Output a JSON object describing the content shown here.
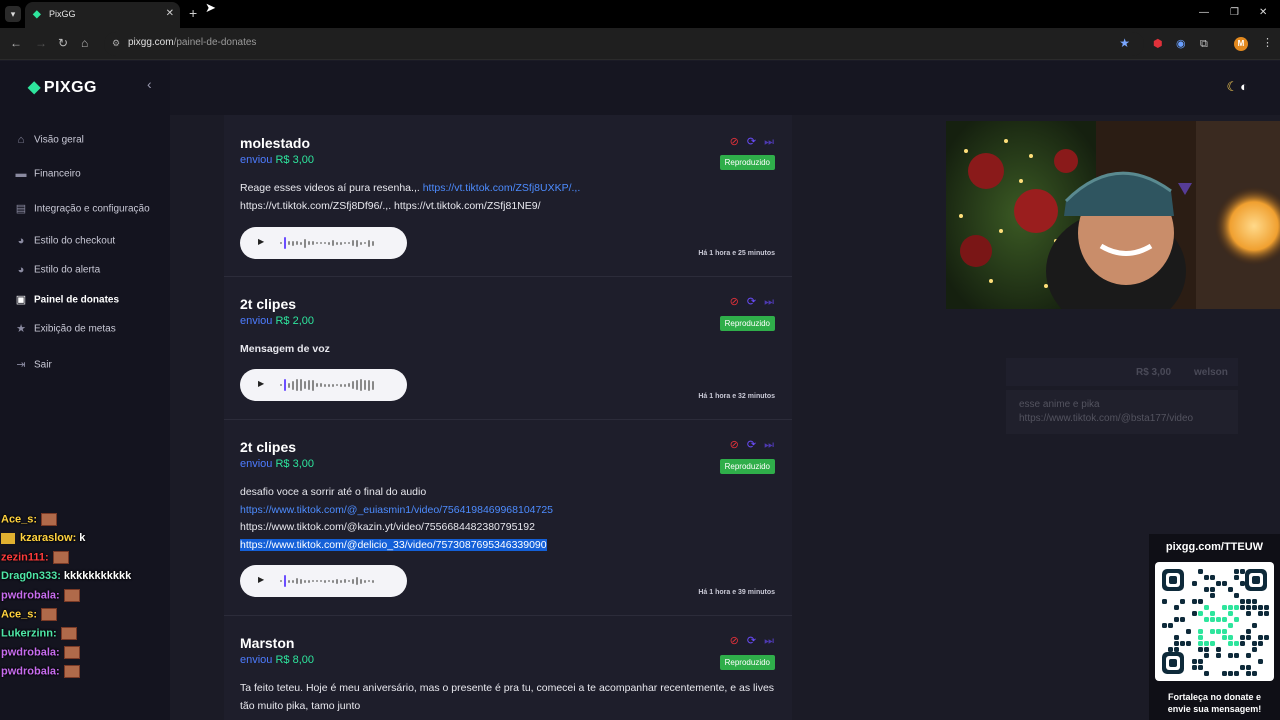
{
  "browser": {
    "tab_title": "PixGG",
    "url_domain": "pixgg.com",
    "url_path": "/painel-de-donates"
  },
  "app": {
    "logo": "PIXGG",
    "sidebar": [
      {
        "label": "Visão geral",
        "icon": "home-icon"
      },
      {
        "label": "Financeiro",
        "icon": "card-icon"
      },
      {
        "label": "Integração e configuração",
        "icon": "settings-icon"
      },
      {
        "label": "Estilo do checkout",
        "icon": "palette-icon"
      },
      {
        "label": "Estilo do alerta",
        "icon": "palette-icon"
      },
      {
        "label": "Painel de donates",
        "icon": "gift-icon",
        "active": true
      },
      {
        "label": "Exibição de metas",
        "icon": "star-icon"
      },
      {
        "label": "Sair",
        "icon": "logout-icon"
      }
    ]
  },
  "donations": [
    {
      "name": "molestado",
      "sent_label": "enviou",
      "amount": "R$ 3,00",
      "status": "Reproduzido",
      "message_parts": [
        {
          "t": "Reage esses videos aí pura resenha.,. ",
          "kind": "plain"
        },
        {
          "t": "https://vt.tiktok.com/ZSfj8UXKP/.,.",
          "kind": "link"
        },
        {
          "t": "https://vt.tiktok.com/ZSfj8Df96/.,. https://vt.tiktok.com/ZSfj81NE9/",
          "kind": "plain",
          "newline": true
        }
      ],
      "time": "Há 1 hora e 25 minutos"
    },
    {
      "name": "2t clipes",
      "sent_label": "enviou",
      "amount": "R$ 2,00",
      "status": "Reproduzido",
      "message_parts": [
        {
          "t": "Mensagem de voz",
          "kind": "bold"
        }
      ],
      "time": "Há 1 hora e 32 minutos"
    },
    {
      "name": "2t clipes",
      "sent_label": "enviou",
      "amount": "R$ 3,00",
      "status": "Reproduzido",
      "message_parts": [
        {
          "t": "desafio voce a sorrir até o final do audio",
          "kind": "plain"
        },
        {
          "t": "https://www.tiktok.com/@_euiasmin1/video/7564198469968104725",
          "kind": "link",
          "newline": true
        },
        {
          "t": "https://www.tiktok.com/@kazin.yt/video/7556684482380795192",
          "kind": "plain",
          "newline": true
        },
        {
          "t": "https://www.tiktok.com/@delicio_33/video/7573087695346339090",
          "kind": "sel",
          "newline": true
        }
      ],
      "time": "Há 1 hora e 39 minutos"
    },
    {
      "name": "Marston",
      "sent_label": "enviou",
      "amount": "R$ 8,00",
      "status": "Reproduzido",
      "message_parts": [
        {
          "t": "Ta feito teteu. Hoje é meu aniversário, mas o presente é pra tu, comecei a te acompanhar recentemente, e as lives tão muito pika, tamo junto",
          "kind": "plain"
        }
      ],
      "time": ""
    }
  ],
  "ghost_donation": {
    "amount": "R$ 3,00",
    "user": "welson",
    "line1": "esse anime e pika",
    "line2": "https://www.tiktok.com/@bsta177/video"
  },
  "chat": [
    {
      "user": "Ace_s:",
      "color": "#ffd23f",
      "msg": "",
      "emote": true
    },
    {
      "user": "kzaraslow:",
      "color": "#ffd23f",
      "msg": "k",
      "badge": true
    },
    {
      "user": "zezin111:",
      "color": "#ff3b3b",
      "msg": "",
      "emote": true
    },
    {
      "user": "Drag0n333:",
      "color": "#4fe7a8",
      "msg": "kkkkkkkkkkk"
    },
    {
      "user": "pwdrobala:",
      "color": "#c86df0",
      "msg": "",
      "emote": true
    },
    {
      "user": "Ace_s:",
      "color": "#ffd23f",
      "msg": "",
      "emote": true
    },
    {
      "user": "Lukerzinn:",
      "color": "#4fe7a8",
      "msg": "",
      "emote": true
    },
    {
      "user": "pwdrobala:",
      "color": "#c86df0",
      "msg": "",
      "emote": true
    },
    {
      "user": "pwdrobala:",
      "color": "#c86df0",
      "msg": "",
      "emote": true
    }
  ],
  "qr": {
    "url": "pixgg.com/TTEUW",
    "footer_line1": "Fortaleça no donate e",
    "footer_line2": "envie sua mensagem!"
  },
  "colors": {
    "accent_green": "#2ee59d",
    "link_blue": "#4d8cff",
    "status_green": "#2fae4a",
    "block_red": "#e0313a",
    "replay_purple": "#6b4dff"
  }
}
